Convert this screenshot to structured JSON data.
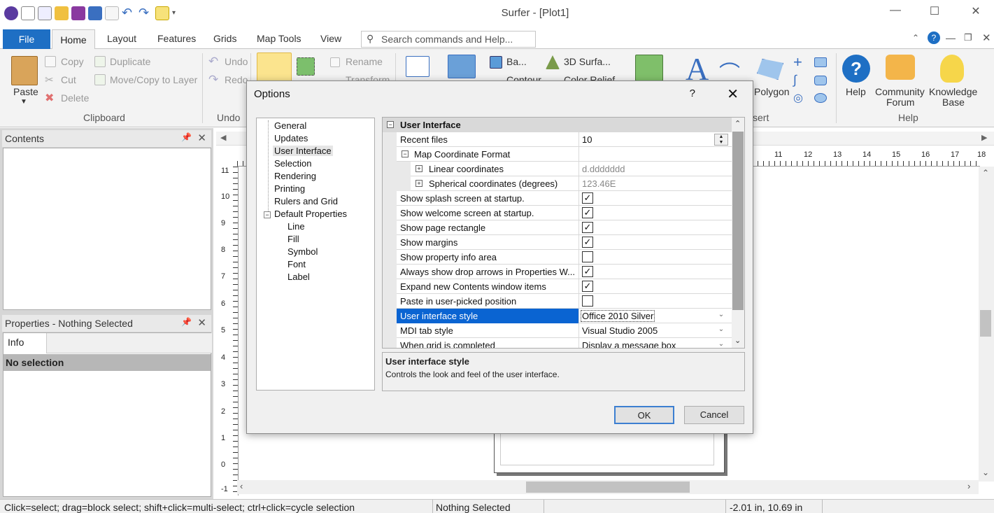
{
  "app": {
    "title": "Surfer - [Plot1]",
    "window_controls": [
      "minimize",
      "maximize",
      "close"
    ]
  },
  "ribbon_tabs": [
    "File",
    "Home",
    "Layout",
    "Features",
    "Grids",
    "Map Tools",
    "View"
  ],
  "search": {
    "placeholder": "Search commands and Help..."
  },
  "ribbon": {
    "clipboard": {
      "paste": "Paste",
      "copy": "Copy",
      "cut": "Cut",
      "delete": "Delete",
      "duplicate": "Duplicate",
      "move_copy": "Move/Copy to Layer",
      "group": "Clipboard"
    },
    "undo": {
      "undo": "Undo",
      "redo": "Redo",
      "rename": "Rename",
      "transform": "Transform",
      "group": "Undo"
    },
    "maps": {
      "base": "Ba...",
      "surface": "3D Surfa...",
      "contour": "Contour",
      "color_relief": "Color Relief"
    },
    "insert": {
      "polygon": "Polygon",
      "group": "sert"
    },
    "help": {
      "help": "Help",
      "community": "Community Forum",
      "community_l1": "Community",
      "community_l2": "Forum",
      "knowledge": "Knowledge Base",
      "knowledge_l1": "Knowledge",
      "knowledge_l2": "Base",
      "group": "Help"
    }
  },
  "contents_pane": {
    "title": "Contents"
  },
  "properties_pane": {
    "title": "Properties - Nothing Selected",
    "tab": "Info",
    "selection": "No selection"
  },
  "status_bar": {
    "hint": "Click=select; drag=block select; shift+click=multi-select; ctrl+click=cycle selection",
    "selection": "Nothing Selected",
    "coords": "-2.01 in, 10.69 in"
  },
  "ruler": {
    "left_ticks": [
      "11",
      "10",
      "9",
      "8",
      "7",
      "6",
      "5",
      "4",
      "3",
      "2",
      "1",
      "0",
      "-1"
    ],
    "top_ticks": [
      "11",
      "12",
      "13",
      "14",
      "15",
      "16",
      "17",
      "18"
    ]
  },
  "dialog": {
    "title": "Options",
    "help": "?",
    "tree": [
      "General",
      "Updates",
      "User Interface",
      "Selection",
      "Rendering",
      "Printing",
      "Rulers and Grid",
      "Default Properties",
      "Line",
      "Fill",
      "Symbol",
      "Font",
      "Label"
    ],
    "selected_tree_item": "User Interface",
    "section": "User Interface",
    "rows": [
      {
        "label": "Recent files",
        "value": "10"
      },
      {
        "label": "Map Coordinate Format",
        "value": ""
      },
      {
        "label": "Linear coordinates",
        "value": "d.ddddddd"
      },
      {
        "label": "Spherical coordinates (degrees)",
        "value": "123.46E"
      },
      {
        "label": "Show splash screen at startup.",
        "checked": true
      },
      {
        "label": "Show welcome screen at startup.",
        "checked": true
      },
      {
        "label": "Show page rectangle",
        "checked": true
      },
      {
        "label": "Show margins",
        "checked": true
      },
      {
        "label": "Show property info area",
        "checked": false
      },
      {
        "label": "Always show drop arrows in Properties W...",
        "checked": true
      },
      {
        "label": "Expand new Contents window items",
        "checked": true
      },
      {
        "label": "Paste in user-picked position",
        "checked": false
      },
      {
        "label": "User interface style",
        "value": "Office 2010 Silver"
      },
      {
        "label": "MDI tab style",
        "value": "Visual Studio 2005"
      },
      {
        "label": "When grid is completed",
        "value": "Display a message box"
      }
    ],
    "description": {
      "title": "User interface style",
      "text": "Controls the look and feel of the user interface."
    },
    "ok": "OK",
    "cancel": "Cancel"
  },
  "colors": {
    "accent": "#1e6fc4",
    "selection": "#0a64d2"
  }
}
